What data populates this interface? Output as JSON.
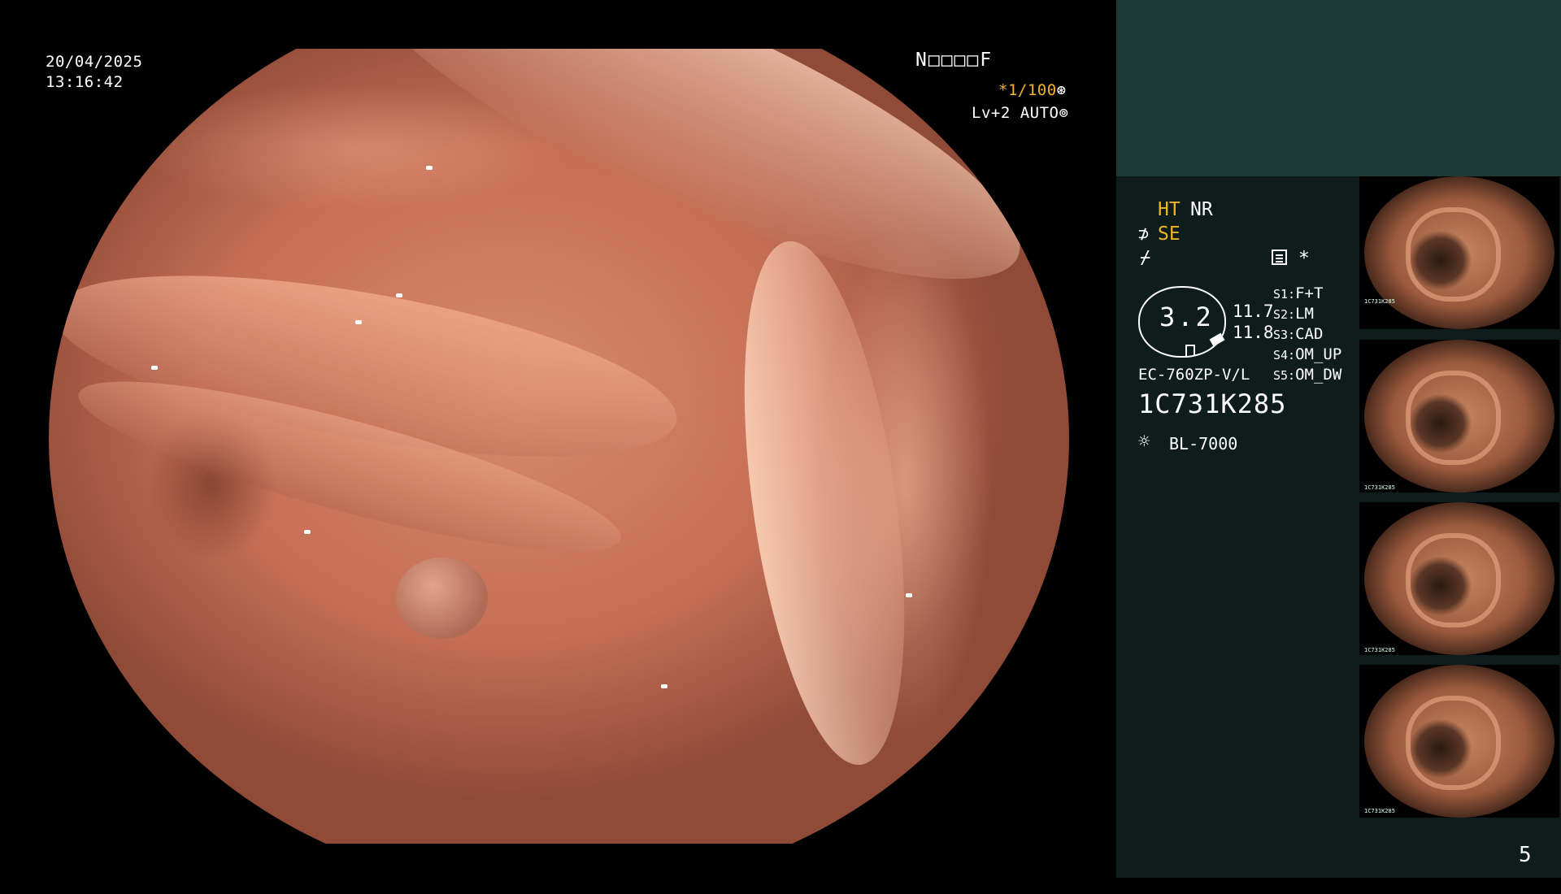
{
  "overlay": {
    "date": "20/04/2025",
    "time": "13:16:42",
    "code": "N□□□□F",
    "shutter": "*1/100",
    "level": "Lv+2 AUTO"
  },
  "panel": {
    "enhance_ht": "HT",
    "enhance_nr": "NR",
    "se_label": "SE",
    "star": "*",
    "dial_value": "3.2",
    "value_top": "11.7",
    "value_bottom": "11.8",
    "scope_settings": [
      {
        "key": "S1:",
        "value": "F+T"
      },
      {
        "key": "S2:",
        "value": "LM"
      },
      {
        "key": "S3:",
        "value": "CAD"
      },
      {
        "key": "S4:",
        "value": "OM_UP"
      },
      {
        "key": "S5:",
        "value": "OM_DW"
      }
    ],
    "scope_model": "EC-760ZP-V/L",
    "scope_serial": "1C731K285",
    "light_source": "BL-7000",
    "page_number": "5"
  },
  "thumbnails": [
    {
      "serial": "1C731K285"
    },
    {
      "serial": "1C731K285"
    },
    {
      "serial": "1C731K285"
    },
    {
      "serial": "1C731K285"
    }
  ],
  "colors": {
    "accent": "#f0b428",
    "panel_bg": "#0e1d1b",
    "panel_header": "#1b3a36"
  }
}
